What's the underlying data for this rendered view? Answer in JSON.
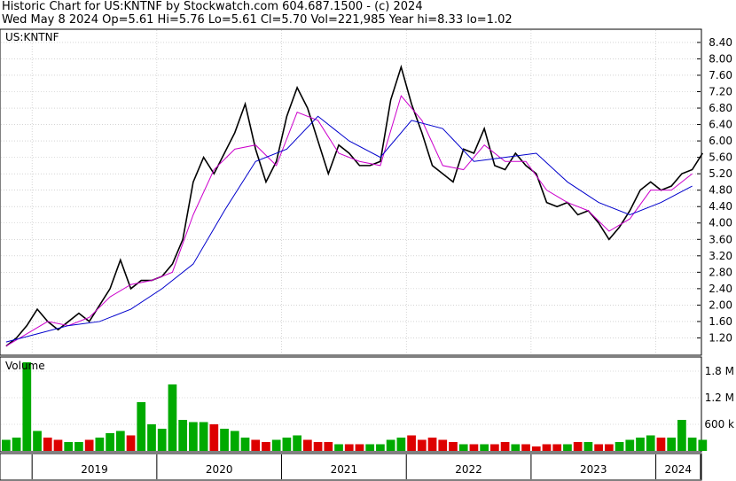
{
  "header": {
    "line1": "Historic Chart for US:KNTNF by Stockwatch.com 604.687.1500 - (c) 2024",
    "line2": "Wed May  8 2024  Op=5.61  Hi=5.76  Lo=5.61  Cl=5.70  Vol=221,985  Year hi=8.33  lo=1.02"
  },
  "colors": {
    "price": "#000000",
    "ma_short": "#cc00cc",
    "ma_long": "#0000cc",
    "vol_up": "#00aa00",
    "vol_down": "#dd0000",
    "grid": "#bbbbbb",
    "frame": "#000000"
  },
  "chart_data": [
    {
      "type": "line",
      "title": "US:KNTNF",
      "price_axis_ticks": [
        "8.40",
        "8.00",
        "7.60",
        "7.20",
        "6.80",
        "6.40",
        "6.00",
        "5.60",
        "5.20",
        "4.80",
        "4.40",
        "4.00",
        "3.60",
        "3.20",
        "2.80",
        "2.40",
        "2.00",
        "1.60",
        "1.20"
      ],
      "ylim": [
        0.8,
        8.7
      ],
      "x_labels": [
        "2019",
        "2020",
        "2021",
        "2022",
        "2023",
        "2024"
      ],
      "xlim": [
        "2018-10",
        "2024-05"
      ],
      "grid": true,
      "series": [
        {
          "name": "",
          "style": "price",
          "x": [
            "2018-10",
            "2018-11",
            "2018-12",
            "2019-01",
            "2019-02",
            "2019-03",
            "2019-04",
            "2019-05",
            "2019-06",
            "2019-07",
            "2019-08",
            "2019-09",
            "2019-10",
            "2019-11",
            "2019-12",
            "2020-01",
            "2020-02",
            "2020-03",
            "2020-04",
            "2020-05",
            "2020-06",
            "2020-07",
            "2020-08",
            "2020-09",
            "2020-10",
            "2020-11",
            "2020-12",
            "2021-01",
            "2021-02",
            "2021-03",
            "2021-04",
            "2021-05",
            "2021-06",
            "2021-07",
            "2021-08",
            "2021-09",
            "2021-10",
            "2021-11",
            "2021-12",
            "2022-01",
            "2022-02",
            "2022-03",
            "2022-04",
            "2022-05",
            "2022-06",
            "2022-07",
            "2022-08",
            "2022-09",
            "2022-10",
            "2022-11",
            "2022-12",
            "2023-01",
            "2023-02",
            "2023-03",
            "2023-04",
            "2023-05",
            "2023-06",
            "2023-07",
            "2023-08",
            "2023-09",
            "2023-10",
            "2023-11",
            "2023-12",
            "2024-01",
            "2024-02",
            "2024-03",
            "2024-04",
            "2024-05"
          ],
          "values": [
            1.0,
            1.2,
            1.5,
            1.9,
            1.6,
            1.4,
            1.6,
            1.8,
            1.6,
            2.0,
            2.4,
            3.1,
            2.4,
            2.6,
            2.6,
            2.7,
            3.0,
            3.6,
            5.0,
            5.6,
            5.2,
            5.7,
            6.2,
            6.9,
            5.8,
            5.0,
            5.5,
            6.6,
            7.3,
            6.8,
            6.0,
            5.2,
            5.9,
            5.7,
            5.4,
            5.4,
            5.5,
            7.0,
            7.8,
            6.9,
            6.2,
            5.4,
            5.2,
            5.0,
            5.8,
            5.7,
            6.3,
            5.4,
            5.3,
            5.7,
            5.4,
            5.2,
            4.5,
            4.4,
            4.5,
            4.2,
            4.3,
            4.0,
            3.6,
            3.9,
            4.3,
            4.8,
            5.0,
            4.8,
            4.9,
            5.2,
            5.3,
            5.7
          ]
        },
        {
          "name": "",
          "style": "ma_short",
          "x": [
            "2018-10",
            "2018-12",
            "2019-02",
            "2019-04",
            "2019-06",
            "2019-08",
            "2019-10",
            "2019-12",
            "2020-02",
            "2020-04",
            "2020-06",
            "2020-08",
            "2020-10",
            "2020-12",
            "2021-02",
            "2021-04",
            "2021-06",
            "2021-08",
            "2021-10",
            "2021-12",
            "2022-02",
            "2022-04",
            "2022-06",
            "2022-08",
            "2022-10",
            "2022-12",
            "2023-02",
            "2023-04",
            "2023-06",
            "2023-08",
            "2023-10",
            "2023-12",
            "2024-02",
            "2024-04"
          ],
          "values": [
            1.0,
            1.3,
            1.6,
            1.5,
            1.7,
            2.2,
            2.5,
            2.6,
            2.8,
            4.2,
            5.3,
            5.8,
            5.9,
            5.4,
            6.7,
            6.5,
            5.7,
            5.5,
            5.4,
            7.1,
            6.5,
            5.4,
            5.3,
            5.9,
            5.5,
            5.5,
            4.8,
            4.5,
            4.3,
            3.8,
            4.1,
            4.8,
            4.8,
            5.2
          ]
        },
        {
          "name": "",
          "style": "ma_long",
          "x": [
            "2018-10",
            "2019-01",
            "2019-04",
            "2019-07",
            "2019-10",
            "2020-01",
            "2020-04",
            "2020-07",
            "2020-10",
            "2021-01",
            "2021-04",
            "2021-07",
            "2021-10",
            "2022-01",
            "2022-04",
            "2022-07",
            "2022-10",
            "2023-01",
            "2023-04",
            "2023-07",
            "2023-10",
            "2024-01",
            "2024-04"
          ],
          "values": [
            1.1,
            1.3,
            1.5,
            1.6,
            1.9,
            2.4,
            3.0,
            4.3,
            5.5,
            5.8,
            6.6,
            6.0,
            5.6,
            6.5,
            6.3,
            5.5,
            5.6,
            5.7,
            5.0,
            4.5,
            4.2,
            4.5,
            4.9
          ]
        }
      ]
    },
    {
      "type": "bar",
      "title": "Volume",
      "volume_axis_ticks": [
        "1.8 M",
        "1.2 M",
        "600 k"
      ],
      "ylim": [
        0,
        2100000
      ],
      "grid": true,
      "x": [
        "2018-10",
        "2018-11",
        "2018-12",
        "2019-01",
        "2019-02",
        "2019-03",
        "2019-04",
        "2019-05",
        "2019-06",
        "2019-07",
        "2019-08",
        "2019-09",
        "2019-10",
        "2019-11",
        "2019-12",
        "2020-01",
        "2020-02",
        "2020-03",
        "2020-04",
        "2020-05",
        "2020-06",
        "2020-07",
        "2020-08",
        "2020-09",
        "2020-10",
        "2020-11",
        "2020-12",
        "2021-01",
        "2021-02",
        "2021-03",
        "2021-04",
        "2021-05",
        "2021-06",
        "2021-07",
        "2021-08",
        "2021-09",
        "2021-10",
        "2021-11",
        "2021-12",
        "2022-01",
        "2022-02",
        "2022-03",
        "2022-04",
        "2022-05",
        "2022-06",
        "2022-07",
        "2022-08",
        "2022-09",
        "2022-10",
        "2022-11",
        "2022-12",
        "2023-01",
        "2023-02",
        "2023-03",
        "2023-04",
        "2023-05",
        "2023-06",
        "2023-07",
        "2023-08",
        "2023-09",
        "2023-10",
        "2023-11",
        "2023-12",
        "2024-01",
        "2024-02",
        "2024-03",
        "2024-04",
        "2024-05"
      ],
      "values": [
        250000,
        300000,
        2000000,
        450000,
        300000,
        250000,
        200000,
        200000,
        250000,
        300000,
        400000,
        450000,
        350000,
        1100000,
        600000,
        500000,
        1500000,
        700000,
        650000,
        650000,
        600000,
        500000,
        450000,
        300000,
        250000,
        200000,
        250000,
        300000,
        350000,
        250000,
        200000,
        200000,
        150000,
        150000,
        150000,
        150000,
        150000,
        250000,
        300000,
        350000,
        250000,
        300000,
        250000,
        200000,
        150000,
        150000,
        150000,
        150000,
        200000,
        150000,
        150000,
        100000,
        150000,
        150000,
        150000,
        200000,
        200000,
        150000,
        150000,
        200000,
        250000,
        300000,
        350000,
        300000,
        300000,
        700000,
        300000,
        250000
      ]
    }
  ]
}
